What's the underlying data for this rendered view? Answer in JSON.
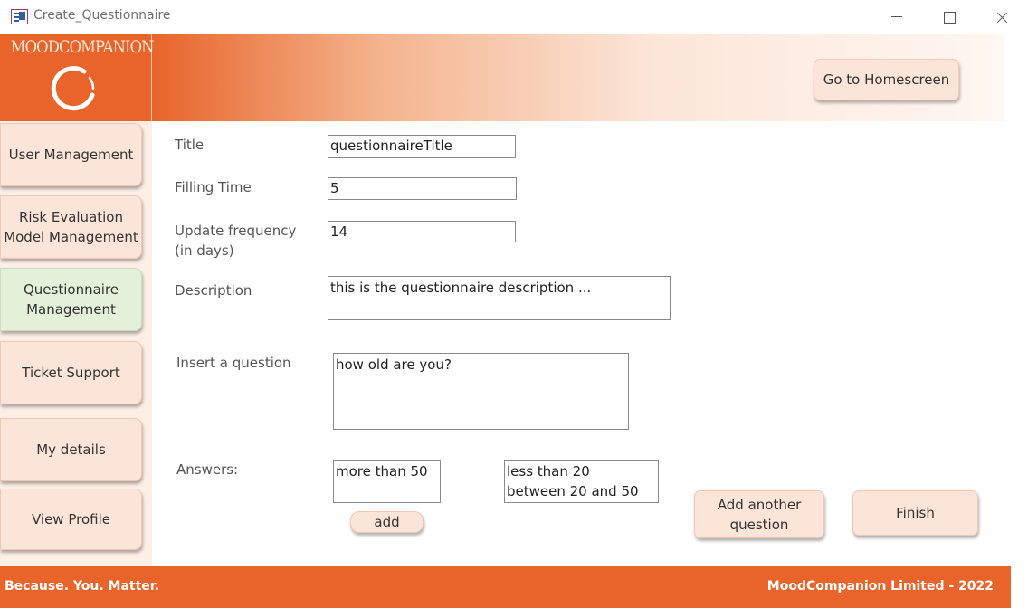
{
  "window": {
    "title": "Create_Questionnaire"
  },
  "header": {
    "logo_text": "MOODCOMPANION",
    "home_button": "Go to Homescreen"
  },
  "sidebar": {
    "items": [
      {
        "label": "User Management"
      },
      {
        "label": "Risk Evaluation Model Management"
      },
      {
        "label": "Questionnaire Management",
        "active": true
      },
      {
        "label": "Ticket Support"
      },
      {
        "label": "My details"
      },
      {
        "label": "View Profile"
      }
    ]
  },
  "form": {
    "title_label": "Title",
    "title_value": "questionnaireTitle",
    "filling_time_label": "Filling Time",
    "filling_time_value": "5",
    "update_frequency_label_1": "Update frequency",
    "update_frequency_label_2": "(in days)",
    "update_frequency_value": "14",
    "description_label": "Description",
    "description_value": "this is the questionnaire description ...",
    "question_label": "Insert a question",
    "question_value": "how old are you?",
    "answers_label": "Answers:",
    "answer_input_value": "more than 50",
    "answers_list": [
      "less than 20",
      "between 20 and 50"
    ],
    "add_button": "add",
    "add_question_button": "Add another question",
    "finish_button": "Finish"
  },
  "footer": {
    "tagline": "Because. You. Matter.",
    "copyright": "MoodCompanion Limited - 2022"
  },
  "colors": {
    "brand_orange": "#e8642a",
    "button_peach": "#fbe5d8",
    "active_green": "#e3f0da"
  }
}
